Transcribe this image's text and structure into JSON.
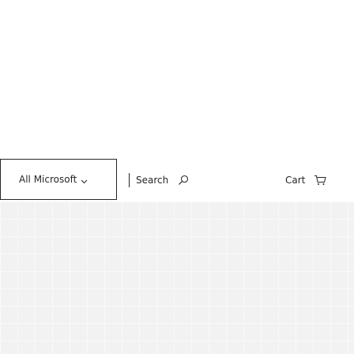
{
  "nav": {
    "all_microsoft_label": "All Microsoft",
    "search_label": "Search",
    "cart_label": "Cart"
  },
  "icons": {
    "all_microsoft": "chevron-down-icon",
    "search": "search-icon",
    "cart": "cart-icon"
  },
  "colors": {
    "text": "#262626",
    "background": "#ffffff",
    "grid_background": "#f2f2f2"
  }
}
